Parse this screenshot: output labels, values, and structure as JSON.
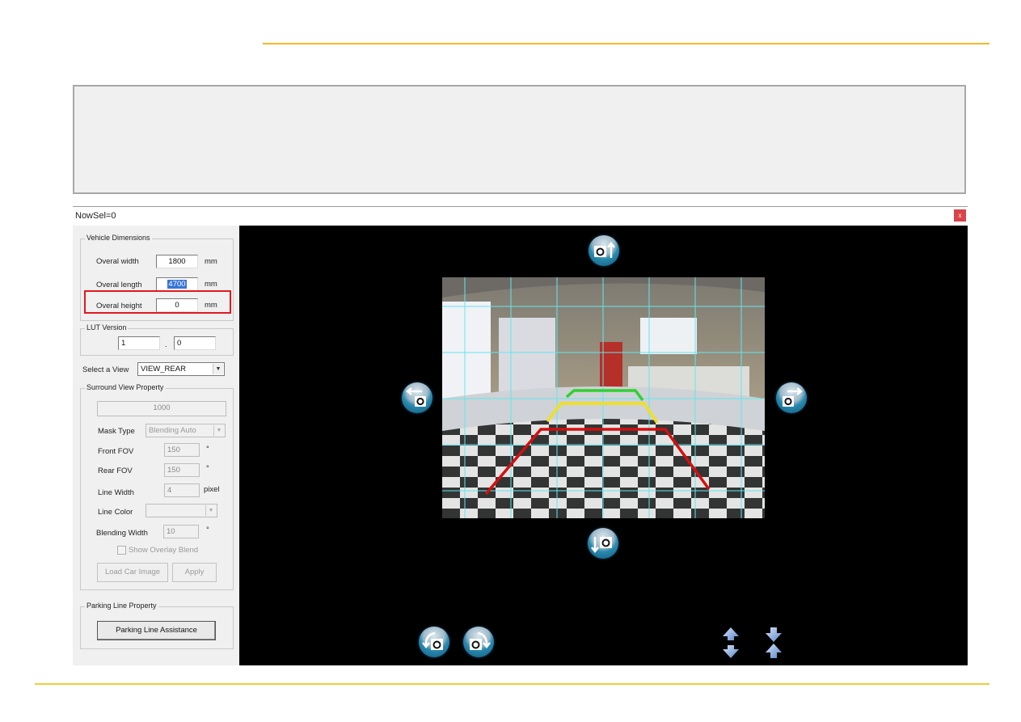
{
  "window": {
    "title": "NowSel=0",
    "close_label": "x"
  },
  "vehicle_dimensions": {
    "label": "Vehicle Dimensions",
    "width": {
      "label": "Overal width",
      "value": "1800",
      "unit": "mm"
    },
    "length": {
      "label": "Overal length",
      "value": "4700",
      "unit": "mm"
    },
    "height": {
      "label": "Overal height",
      "value": "0",
      "unit": "mm"
    }
  },
  "lut_version": {
    "label": "LUT Version",
    "major": "1",
    "separator": ".",
    "minor": "0"
  },
  "view_select": {
    "label": "Select a View",
    "value": "VIEW_REAR"
  },
  "surround_view": {
    "label": "Surround View Property",
    "top_value": "1000",
    "mask_type": {
      "label": "Mask Type",
      "value": "Blending Auto"
    },
    "front_fov": {
      "label": "Front FOV",
      "value": "150",
      "unit": "°"
    },
    "rear_fov": {
      "label": "Rear FOV",
      "value": "150",
      "unit": "°"
    },
    "line_width": {
      "label": "Line Width",
      "value": "4",
      "unit": "pixel"
    },
    "line_color": {
      "label": "Line Color",
      "value": ""
    },
    "blending_width": {
      "label": "Blending Width",
      "value": "10",
      "unit": "°"
    },
    "show_overlay_blend": {
      "label": "Show Overlay Blend",
      "checked": false
    },
    "load_car_image_label": "Load Car Image",
    "apply_label": "Apply"
  },
  "parking_line": {
    "label": "Parking Line Property",
    "button_label": "Parking Line Assistance"
  },
  "viewer": {
    "controls": [
      {
        "name": "camera-move-up",
        "icon": "camera-up-arrow-icon"
      },
      {
        "name": "camera-move-left",
        "icon": "camera-left-arrow-icon"
      },
      {
        "name": "camera-move-right",
        "icon": "camera-right-arrow-icon"
      },
      {
        "name": "camera-move-down",
        "icon": "camera-down-arrow-icon"
      },
      {
        "name": "camera-rotate-ccw",
        "icon": "camera-rotate-left-icon"
      },
      {
        "name": "camera-rotate-cw",
        "icon": "camera-rotate-right-icon"
      },
      {
        "name": "expand-vertical",
        "icon": "expand-vertical-arrows-icon"
      },
      {
        "name": "shrink-vertical",
        "icon": "shrink-vertical-arrows-icon"
      }
    ],
    "guide_line_colors": {
      "near": "#d40f0f",
      "mid": "#f0e020",
      "far": "#2fd12f"
    },
    "grid_color": "#5fe8f0"
  },
  "colors": {
    "accent_rule": "#f5b82a",
    "highlight": "#e0191d",
    "close_button": "#d9434a"
  }
}
